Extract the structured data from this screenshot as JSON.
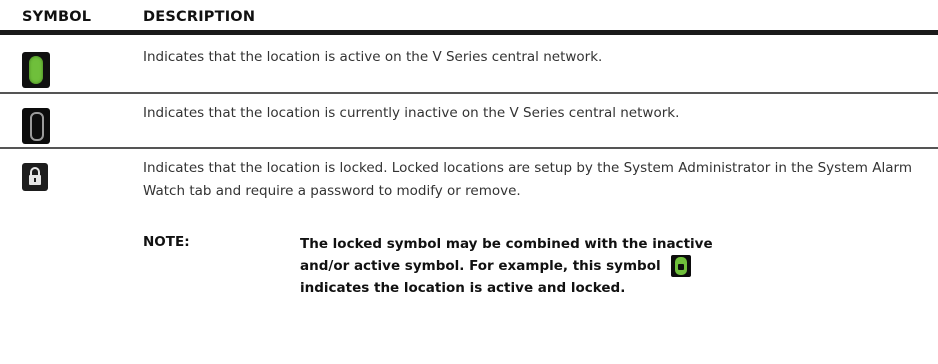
{
  "table": {
    "headers": {
      "symbol": "SYMBOL",
      "description": "DESCRIPTION"
    },
    "rows": [
      {
        "icon": "active-location-icon",
        "description": "Indicates that the location is active on the V Series central network."
      },
      {
        "icon": "inactive-location-icon",
        "description": "Indicates that the location is currently inactive on the V Series central network."
      },
      {
        "icon": "locked-location-icon",
        "description": "Indicates that the location is locked. Locked locations are setup by the System Administrator in the System Alarm Watch tab and require a password to modify or remove."
      }
    ],
    "note": {
      "label": "NOTE:",
      "text_before": "The locked symbol may be combined with the inactive and/or active symbol. For example, this symbol",
      "text_after": "indicates the location is active and locked.",
      "icon": "active-locked-icon"
    }
  },
  "colors": {
    "active_green": "#6fbf3b",
    "icon_background": "#101010",
    "rule": "#1a1a1a"
  }
}
